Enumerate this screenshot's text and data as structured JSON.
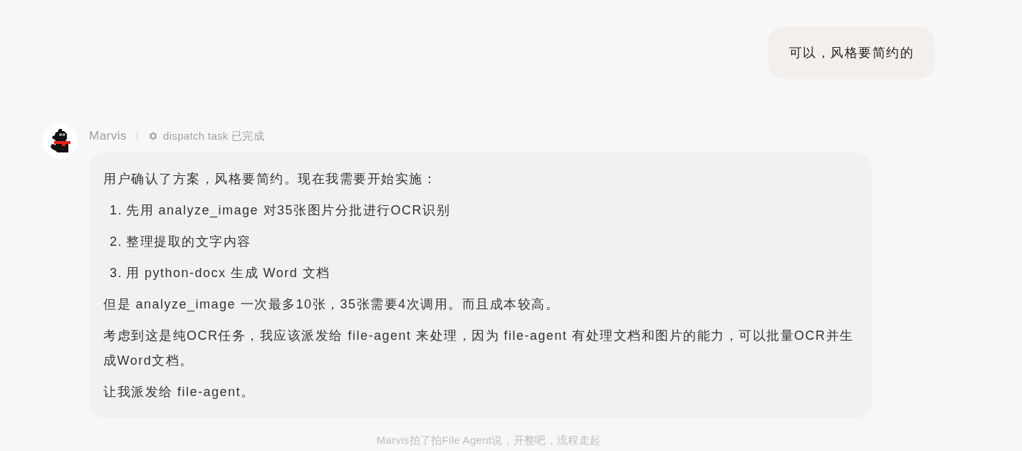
{
  "messages": [
    {
      "kind": "user",
      "text": "可以，风格要简约的"
    },
    {
      "kind": "agent",
      "sender": "Marvis",
      "status": "dispatch task 已完成",
      "blocks": [
        {
          "kind": "paragraph",
          "text": "用户确认了方案，风格要简约。现在我需要开始实施："
        },
        {
          "kind": "list_item",
          "number": "1.",
          "text": "先用 analyze_image 对35张图片分批进行OCR识别"
        },
        {
          "kind": "list_item",
          "number": "2.",
          "text": "整理提取的文字内容"
        },
        {
          "kind": "list_item",
          "number": "3.",
          "text": "用 python-docx 生成 Word 文档"
        },
        {
          "kind": "paragraph",
          "text": "但是 analyze_image 一次最多10张，35张需要4次调用。而且成本较高。"
        },
        {
          "kind": "paragraph",
          "text": "考虑到这是纯OCR任务，我应该派发给 file-agent 来处理，因为 file-agent 有处理文档和图片的能力，可以批量OCR并生成Word文档。"
        },
        {
          "kind": "paragraph",
          "text": "让我派发给 file-agent。"
        }
      ]
    }
  ],
  "footer_note": "Marvis拍了拍File Agent说，开整吧，流程走起"
}
